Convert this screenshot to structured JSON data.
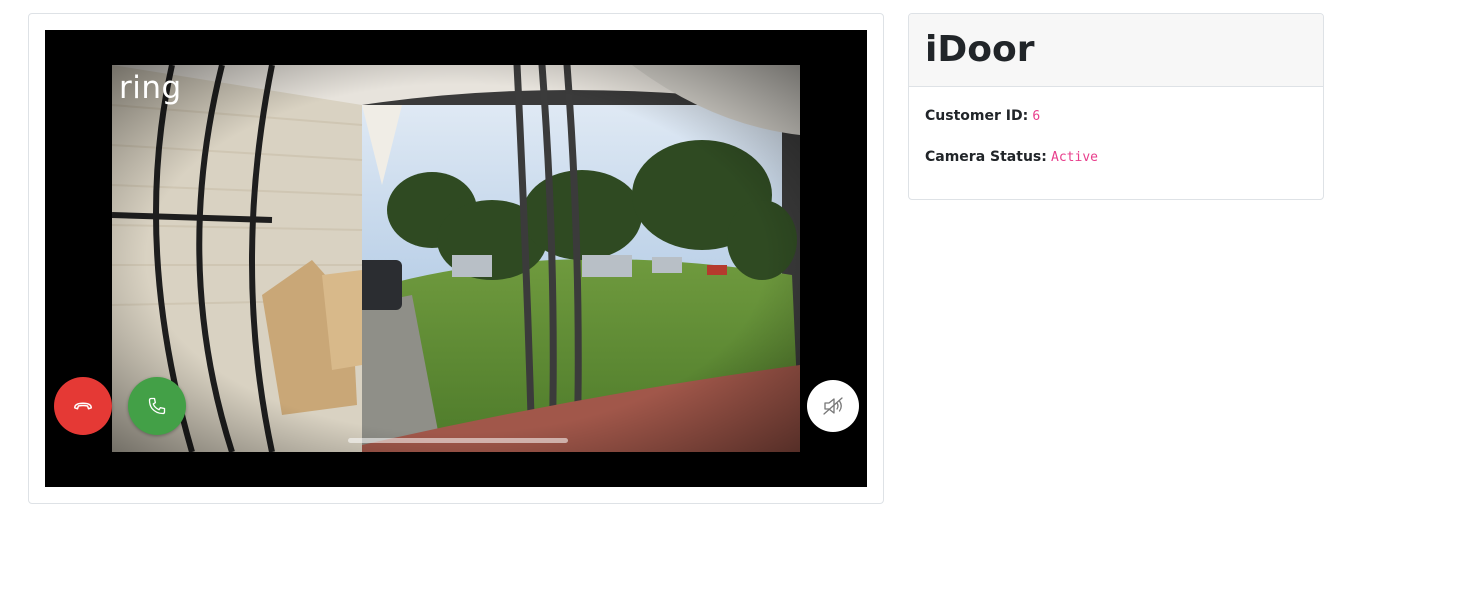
{
  "app": {
    "title": "iDoor"
  },
  "video": {
    "brand_logo": "ring",
    "buttons": {
      "decline": {
        "icon": "phone-hangup-icon",
        "color": "#e53935"
      },
      "answer": {
        "icon": "phone-icon",
        "color": "#43a047"
      },
      "mute": {
        "icon": "speaker-muted-icon",
        "color": "#ffffff"
      }
    }
  },
  "info": {
    "customer_id_label": "Customer ID:",
    "customer_id_value": "6",
    "camera_status_label": "Camera Status:",
    "camera_status_value": "Active"
  },
  "colors": {
    "code_text": "#e83e8c",
    "card_border": "#dee2e6",
    "header_bg": "#f7f7f7"
  }
}
